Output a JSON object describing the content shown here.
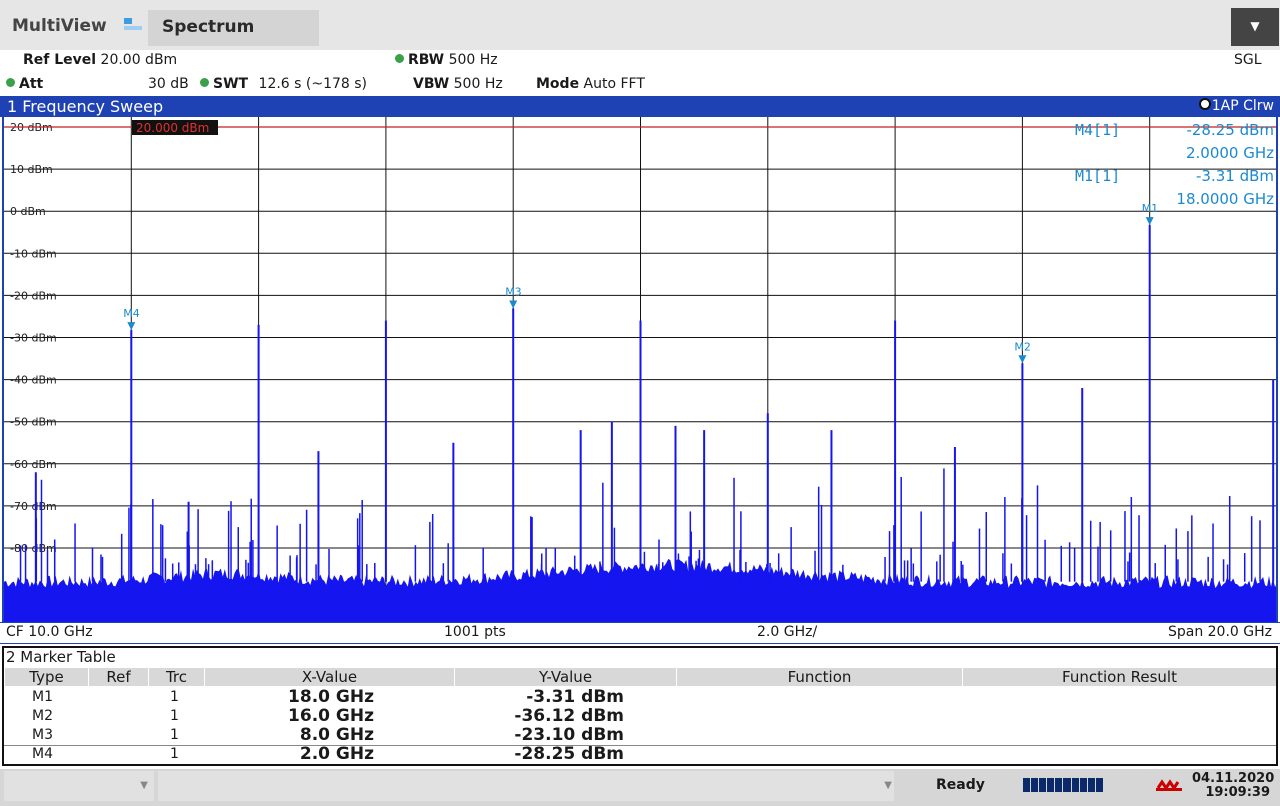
{
  "app": {
    "title": "MultiView",
    "tab": "Spectrum",
    "dropdown_icon": "dropdown-arrow-icon",
    "sgl": "SGL"
  },
  "settings": {
    "ref_level_label": "Ref Level",
    "ref_level_value": "20.00 dBm",
    "att_label": "Att",
    "att_value": "30 dB",
    "swt_label": "SWT",
    "swt_value": "12.6 s (~178 s)",
    "rbw_label": "RBW",
    "rbw_value": "500 Hz",
    "vbw_label": "VBW",
    "vbw_value": "500 Hz",
    "mode_label": "Mode",
    "mode_value": "Auto FFT",
    "indicator_color": "#3aa04a"
  },
  "diagram": {
    "title": "1 Frequency Sweep",
    "trace_label": "1AP Clrw",
    "ref_line_label": "20.000 dBm",
    "marker_readout": [
      {
        "name": "M4[1]",
        "level": "-28.25 dBm",
        "freq": "2.0000 GHz"
      },
      {
        "name": "M1[1]",
        "level": "-3.31 dBm",
        "freq": "18.0000 GHz"
      }
    ],
    "marker_labels": [
      "M1",
      "M2",
      "M3",
      "M4"
    ]
  },
  "footer": {
    "cf": "CF 10.0 GHz",
    "pts": "1001 pts",
    "div": "2.0 GHz/",
    "span": "Span 20.0 GHz"
  },
  "chart_data": {
    "type": "line",
    "xlabel": "",
    "ylabel": "",
    "xlim": [
      0,
      20
    ],
    "ylim": [
      -100,
      20
    ],
    "y_ticks": [
      "20 dBm",
      "10 dBm",
      "0 dBm",
      "-10 dBm",
      "-20 dBm",
      "-30 dBm",
      "-40 dBm",
      "-50 dBm",
      "-60 dBm",
      "-70 dBm",
      "-80 dBm",
      "-90 dBm"
    ],
    "grid": true,
    "reference_level_dbm": 20.0,
    "noise_floor_dbm": -88,
    "trace_color": "#1515f0",
    "peaks": [
      {
        "x": 2.0,
        "y": -28.25
      },
      {
        "x": 4.0,
        "y": -27
      },
      {
        "x": 6.0,
        "y": -26
      },
      {
        "x": 8.0,
        "y": -23.1
      },
      {
        "x": 10.0,
        "y": -26
      },
      {
        "x": 12.0,
        "y": -48
      },
      {
        "x": 14.0,
        "y": -26
      },
      {
        "x": 16.0,
        "y": -36.12
      },
      {
        "x": 18.0,
        "y": -3.31
      },
      {
        "x": 0.5,
        "y": -62
      },
      {
        "x": 2.9,
        "y": -69
      },
      {
        "x": 4.94,
        "y": -57
      },
      {
        "x": 7.06,
        "y": -55
      },
      {
        "x": 9.06,
        "y": -52
      },
      {
        "x": 9.55,
        "y": -50
      },
      {
        "x": 10.55,
        "y": -51
      },
      {
        "x": 11.0,
        "y": -52
      },
      {
        "x": 13.0,
        "y": -52
      },
      {
        "x": 14.94,
        "y": -56
      },
      {
        "x": 16.94,
        "y": -42
      },
      {
        "x": 19.94,
        "y": -40
      }
    ],
    "markers": [
      {
        "name": "M1",
        "x": 18.0,
        "y": -3.31
      },
      {
        "name": "M2",
        "x": 16.0,
        "y": -36.12
      },
      {
        "name": "M3",
        "x": 8.0,
        "y": -23.1
      },
      {
        "name": "M4",
        "x": 2.0,
        "y": -28.25
      }
    ]
  },
  "marker_table": {
    "title": "2 Marker Table",
    "columns": [
      "Type",
      "Ref",
      "Trc",
      "X-Value",
      "Y-Value",
      "Function",
      "Function Result"
    ],
    "rows": [
      {
        "type": "M1",
        "ref": "",
        "trc": "1",
        "x": "18.0 GHz",
        "y": "-3.31 dBm",
        "func": "",
        "result": ""
      },
      {
        "type": "M2",
        "ref": "",
        "trc": "1",
        "x": "16.0 GHz",
        "y": "-36.12 dBm",
        "func": "",
        "result": ""
      },
      {
        "type": "M3",
        "ref": "",
        "trc": "1",
        "x": "8.0 GHz",
        "y": "-23.10 dBm",
        "func": "",
        "result": ""
      },
      {
        "type": "M4",
        "ref": "",
        "trc": "1",
        "x": "2.0 GHz",
        "y": "-28.25 dBm",
        "func": "",
        "result": ""
      }
    ]
  },
  "status": {
    "ready": "Ready",
    "date": "04.11.2020",
    "time": "19:09:39",
    "progress_icon": "progress-bar-icon",
    "logo_icon": "network-icon"
  }
}
